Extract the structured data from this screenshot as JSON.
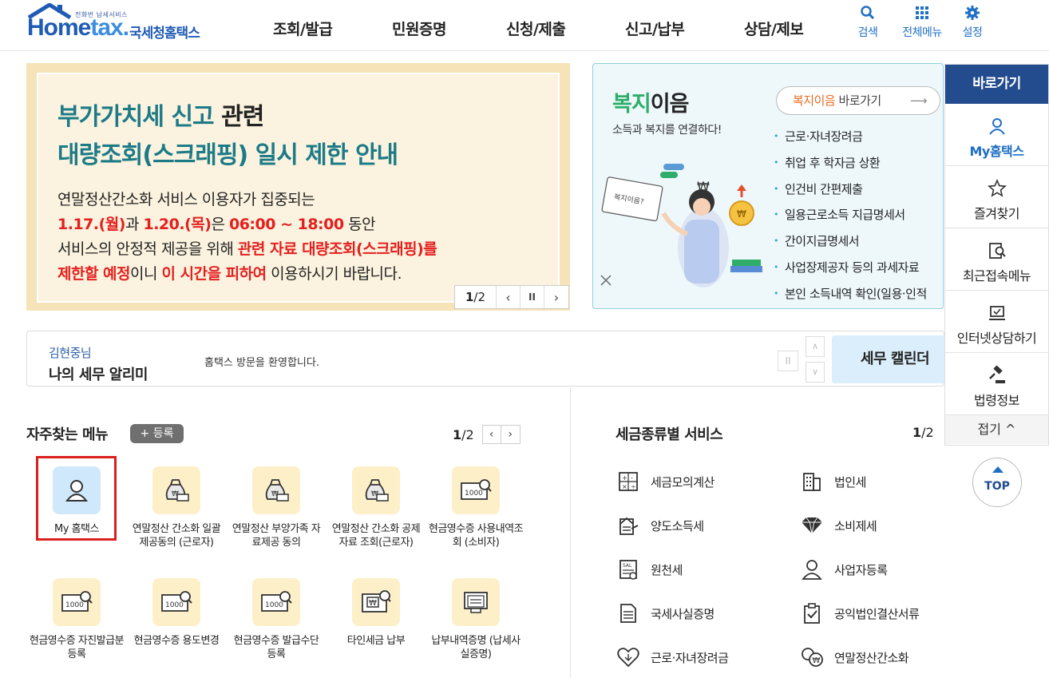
{
  "header": {
    "logo_small": "전화번 납세서비스",
    "logo_home": "Home",
    "logo_tax": "tax.",
    "logo_kr": "국세청홈택스",
    "nav": [
      "조회/발급",
      "민원증명",
      "신청/제출",
      "신고/납부",
      "상담/제보"
    ],
    "util": {
      "search": "검색",
      "all_menu": "전체메뉴",
      "settings": "설정"
    }
  },
  "banner": {
    "title_line1_a": "부가가치세 신고",
    "title_line1_b": " 관련",
    "title_line2": "대량조회(스크래핑) 일시 제한 안내",
    "l1": "연말정산간소화 서비스 이용자가 집중되는",
    "l2_r1": "1.17.(월)",
    "l2_a": "과 ",
    "l2_r2": "1.20.(목)",
    "l2_b": "은 ",
    "l2_r3": "06:00 ~ 18:00",
    "l2_c": " 동안",
    "l3_a": "서비스의 안정적 제공을 위해 ",
    "l3_r": "관련 자료 대량조회(스크래핑)를",
    "l4_r1": "제한할 예정",
    "l4_a": "이니 ",
    "l4_r2": "이 시간을 피하여",
    "l4_b": " 이용하시기 바랍니다.",
    "page_current": "1",
    "page_total": "/2"
  },
  "welfare": {
    "title_green": "복지",
    "title_rest": "이음",
    "subtitle": "소득과 복지를 연결하다!",
    "go_orange": "복지이음",
    "go_rest": " 바로가기",
    "items": [
      "근로·자녀장려금",
      "취업 후 학자금 상환",
      "인건비 간편제출",
      "일용근로소득 지급명세서",
      "간이지급명세서",
      "사업장제공자 등의 과세자료",
      "본인 소득내역 확인(일용·인적"
    ]
  },
  "quick": {
    "title": "바로가기",
    "items": [
      "My홈택스",
      "즐겨찾기",
      "최근접속메뉴",
      "인터넷상담하기",
      "법령정보"
    ],
    "fold": "접기 ^"
  },
  "top_button": "TOP",
  "alert": {
    "user": "김현중님",
    "title": "나의 세무 알리미",
    "message": "홈택스 방문을 환영합니다.",
    "pause": "II",
    "calendar": "세무 캘린더"
  },
  "freq": {
    "title": "자주찾는 메뉴",
    "register": "+ 등록",
    "page_current": "1",
    "page_total": "/2",
    "items": [
      {
        "label": "My 홈택스",
        "icon": "person-icon"
      },
      {
        "label": "연말정산 간소화 일괄제공동의 (근로자)",
        "icon": "money-bag-icon"
      },
      {
        "label": "연말정산 부양가족 자료제공 동의",
        "icon": "money-bag-icon"
      },
      {
        "label": "연말정산 간소화 공제자료 조회(근로자)",
        "icon": "money-bag-icon"
      },
      {
        "label": "현금영수증 사용내역조회 (소비자)",
        "icon": "cash-receipt-icon"
      },
      {
        "label": "현금영수증 자진발급분 등록",
        "icon": "cash-receipt-icon"
      },
      {
        "label": "현금영수증 용도변경",
        "icon": "cash-receipt-icon"
      },
      {
        "label": "현금영수증 발급수단 등록",
        "icon": "cash-receipt-icon"
      },
      {
        "label": "타인세금 납부",
        "icon": "won-payment-icon"
      },
      {
        "label": "납부내역증명 (납세사실증명)",
        "icon": "certificate-icon"
      }
    ]
  },
  "tax_services": {
    "title": "세금종류별 서비스",
    "page_current": "1",
    "page_total": "/2",
    "items": [
      "세금모의계산",
      "법인세",
      "양도소득세",
      "소비제세",
      "원천세",
      "사업자등록",
      "국세사실증명",
      "공익법인결산서류",
      "근로·자녀장려금",
      "연말정산간소화"
    ]
  },
  "colors": {
    "brand": "#234c8f",
    "accent_teal": "#1d7b88",
    "alert_red": "#e4201f",
    "highlight": "#d9201f"
  }
}
